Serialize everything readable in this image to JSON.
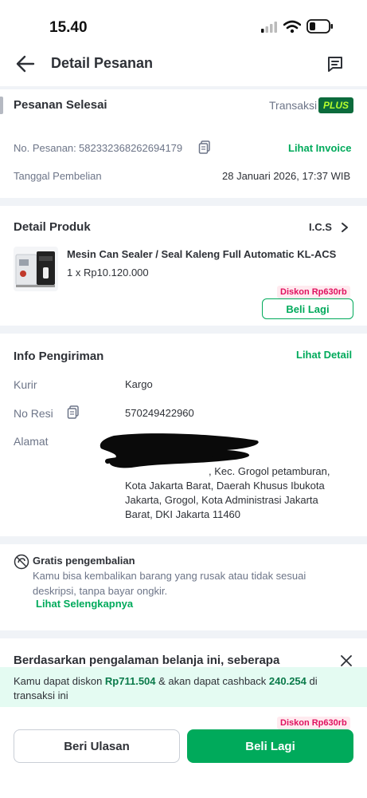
{
  "status_bar": {
    "time": "15.40"
  },
  "header": {
    "title": "Detail Pesanan",
    "back_icon": "arrow-left-icon",
    "chat_icon": "chat-icon"
  },
  "order": {
    "status": "Pesanan Selesai",
    "transaction_label": "Transaksi",
    "plus_badge": "PLUS",
    "order_no_label": "No. Pesanan:",
    "order_no": "582332368262694179",
    "invoice_link": "Lihat Invoice",
    "purchase_date_label": "Tanggal Pembelian",
    "purchase_date": "28 Januari 2026, 17:37 WIB"
  },
  "product": {
    "section_title": "Detail Produk",
    "shop_name": "I.C.S",
    "name": "Mesin Can Sealer / Seal Kaleng Full Automatic KL-ACS",
    "qty_price": "1 x Rp10.120.000",
    "discount": "Diskon Rp630rb",
    "buy_again": "Beli Lagi"
  },
  "shipping": {
    "section_title": "Info Pengiriman",
    "detail_link": "Lihat Detail",
    "courier_label": "Kurir",
    "courier": "Kargo",
    "resi_label": "No Resi",
    "resi": "570249422960",
    "address_label": "Alamat",
    "address_lines": [
      ", Kec. Grogol petamburan,",
      "Kota Jakarta Barat, Daerah Khusus Ibukota",
      "Jakarta, Grogol, Kota Administrasi Jakarta",
      "Barat, DKI Jakarta 11460"
    ]
  },
  "returns": {
    "title": "Gratis pengembalian",
    "desc_lines": [
      "Kamu bisa kembalikan barang yang rusak atau tidak sesuai",
      "deskripsi, tanpa bayar ongkir."
    ],
    "link": "Lihat Selengkapnya"
  },
  "review": {
    "question": "Berdasarkan pengalaman belanja ini, seberapa"
  },
  "cashback": {
    "pre": "Kamu dapat diskon ",
    "discount_value": "Rp711.504",
    "mid": " & akan dapat cashback ",
    "cashback_value": "240.254",
    "post": " di",
    "line2": "transaksi ini"
  },
  "bottom_bar": {
    "discount": "Diskon Rp630rb",
    "review_button": "Beri Ulasan",
    "buy_again_button": "Beli Lagi"
  },
  "colors": {
    "accent": "#00aa5b",
    "discount": "#e0115f",
    "plus_bg": "#0c6b3c",
    "plus_text": "#b5ff2d"
  }
}
